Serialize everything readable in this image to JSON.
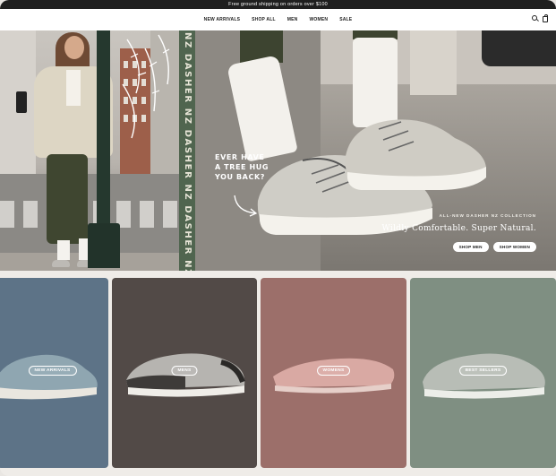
{
  "promo": {
    "text": "Free ground shipping on orders over $100"
  },
  "nav": {
    "links": [
      "NEW ARRIVALS",
      "SHOP ALL",
      "MEN",
      "WOMEN",
      "SALE"
    ],
    "search_icon": "search-icon",
    "bag_icon": "bag-icon"
  },
  "hero": {
    "vertical_text": "NZ DASHER NZ DASHER NZ DASHER NZ DASHER",
    "tagline": [
      "EVER HAVE",
      "A TREE HUG",
      "YOU BACK?"
    ],
    "eyebrow": "ALL-NEW DASHER NZ COLLECTION",
    "headline": "Wildly Comfortable. Super Natural.",
    "buttons": [
      "SHOP MEN",
      "SHOP WOMEN"
    ]
  },
  "tiles": [
    {
      "label": "NEW ARRIVALS",
      "bg": "#5d7387",
      "shoe": "#8fa6b1"
    },
    {
      "label": "MENS",
      "bg": "#524a47",
      "shoe": "#b6b4b0"
    },
    {
      "label": "WOMENS",
      "bg": "#9c6f6a",
      "shoe": "#d9a9a3"
    },
    {
      "label": "BEST SELLERS",
      "bg": "#7f8f82",
      "shoe": "#b8bdb6"
    }
  ]
}
